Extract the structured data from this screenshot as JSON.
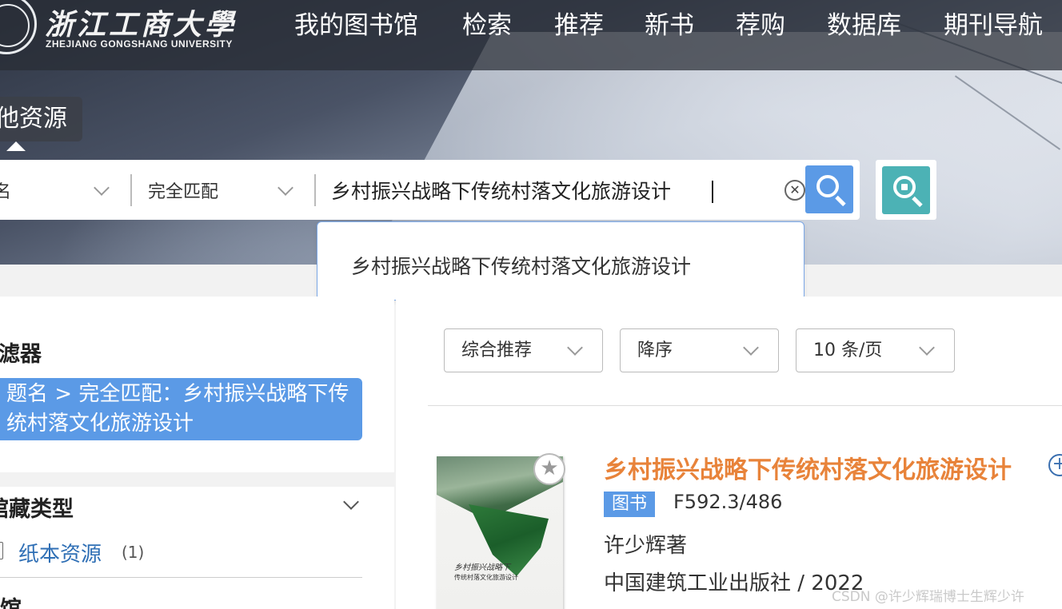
{
  "header": {
    "logo_cn": "浙江工商大學",
    "logo_en": "ZHEJIANG GONGSHANG UNIVERSITY",
    "nav": [
      {
        "label": "我的图书馆"
      },
      {
        "label": "检索"
      },
      {
        "label": "推荐"
      },
      {
        "label": "新书"
      },
      {
        "label": "荐购"
      },
      {
        "label": "数据库"
      },
      {
        "label": "期刊导航"
      }
    ]
  },
  "search": {
    "scope_tab": "他资源",
    "field_select": "名",
    "match_select": "完全匹配",
    "query": "乡村振兴战略下传统村落文化旅游设计",
    "suggestions": [
      "乡村振兴战略下传统村落文化旅游设计"
    ]
  },
  "sidebar": {
    "filter_title": "滤器",
    "active_filter": "题名 > 完全匹配：乡村振兴战略下传统村落文化旅游设计",
    "collection_title": "馆藏类型",
    "collection_items": [
      {
        "label": "纸本资源",
        "count": "(1)"
      }
    ],
    "next_section_title": "馆"
  },
  "toolbar": {
    "sort": "综合推荐",
    "order": "降序",
    "page_size": "10 条/页"
  },
  "results": [
    {
      "title": "乡村振兴战略下传统村落文化旅游设计",
      "type_badge": "图书",
      "call_number": "F592.3/486",
      "author": "许少辉著",
      "publisher_year": "中国建筑工业出版社 / 2022",
      "cover_title": "乡村振兴战略下",
      "cover_subtitle": "传统村落文化旅游设计"
    }
  ],
  "watermark": "CSDN @许少辉瑞博士生辉少许",
  "colors": {
    "accent_blue": "#5b9ae6",
    "teal": "#4cb2b5",
    "title_orange": "#e8833a",
    "link_blue": "#2f6fb5"
  }
}
